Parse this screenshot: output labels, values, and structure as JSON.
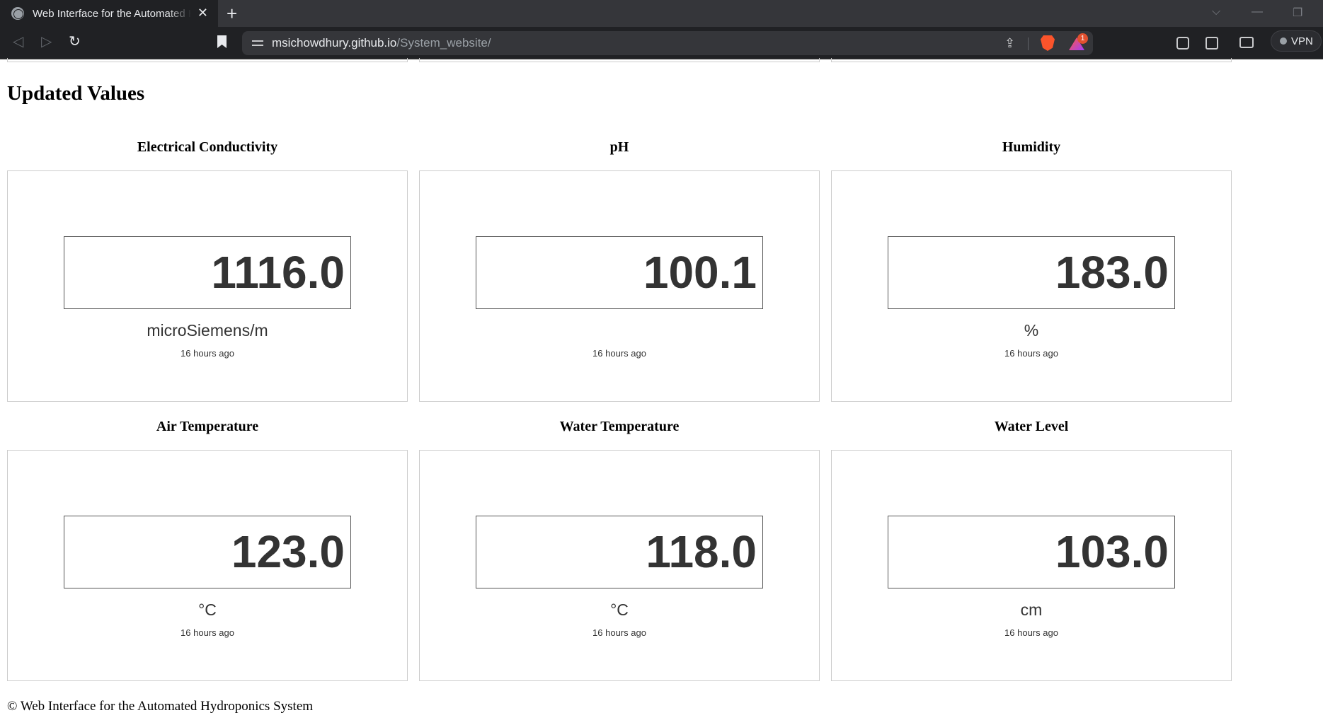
{
  "browser": {
    "tab_title": "Web Interface for the Automated Hydroponics System",
    "tab_close": "✕",
    "new_tab": "+",
    "url_domain": "msichowdhury.github.io",
    "url_path": "/System_website/",
    "rewards_count": "1",
    "vpn_label": "VPN"
  },
  "page": {
    "section_title": "Updated Values",
    "cards": [
      {
        "title": "Electrical Conductivity",
        "value": "1116.0",
        "unit": "microSiemens/m",
        "time": "16 hours ago"
      },
      {
        "title": "pH",
        "value": "100.1",
        "unit": "",
        "time": "16 hours ago"
      },
      {
        "title": "Humidity",
        "value": "183.0",
        "unit": "%",
        "time": "16 hours ago"
      },
      {
        "title": "Air Temperature",
        "value": "123.0",
        "unit": "°C",
        "time": "16 hours ago"
      },
      {
        "title": "Water Temperature",
        "value": "118.0",
        "unit": "°C",
        "time": "16 hours ago"
      },
      {
        "title": "Water Level",
        "value": "103.0",
        "unit": "cm",
        "time": "16 hours ago"
      }
    ],
    "footer": "© Web Interface for the Automated Hydroponics System"
  }
}
